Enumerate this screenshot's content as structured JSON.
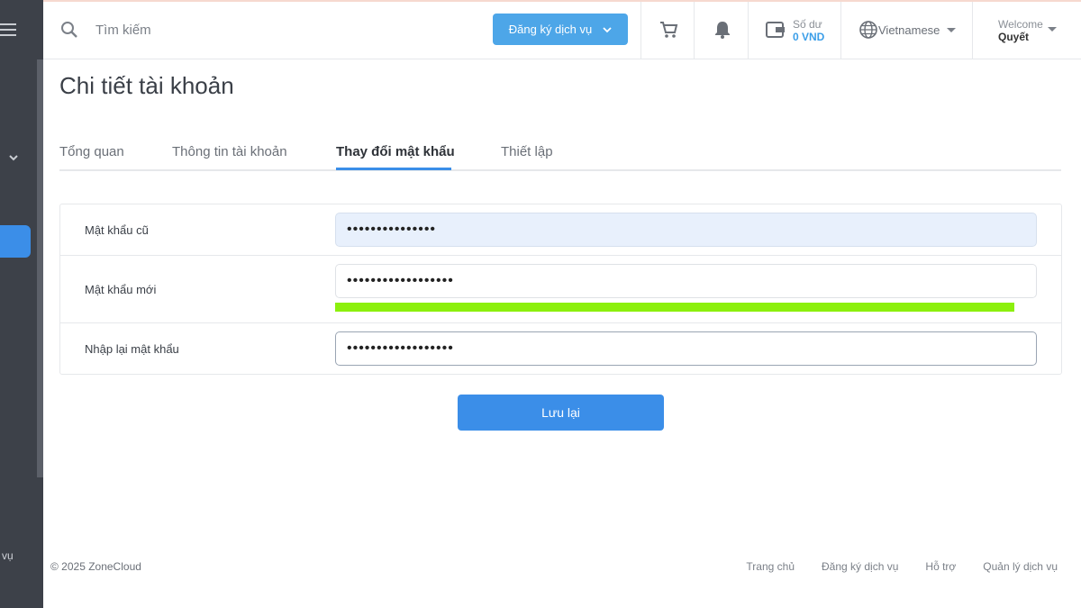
{
  "header": {
    "search_placeholder": "Tìm kiếm",
    "register_label": "Đăng ký dịch vụ",
    "balance_label": "Số dư",
    "balance_value": "0 VND",
    "language": "Vietnamese",
    "welcome_label": "Welcome",
    "user_name": "Quyết"
  },
  "sidebar": {
    "bottom_text": "vụ"
  },
  "page": {
    "title": "Chi tiết tài khoản"
  },
  "tabs": [
    {
      "label": "Tổng quan",
      "active": false
    },
    {
      "label": "Thông tin tài khoản",
      "active": false
    },
    {
      "label": "Thay đổi mật khẩu",
      "active": true
    },
    {
      "label": "Thiết lập",
      "active": false
    }
  ],
  "form": {
    "old_password_label": "Mật khẩu cũ",
    "old_password_value": "•••••••••••••••",
    "new_password_label": "Mật khẩu mới",
    "new_password_value": "••••••••••••••••••",
    "confirm_password_label": "Nhập lại mật khẩu",
    "confirm_password_value": "••••••••••••••••••",
    "strength_level": 1.0,
    "strength_color": "#8cf00d",
    "save_label": "Lưu lại"
  },
  "footer": {
    "copyright": "© 2025 ZoneCloud",
    "links": [
      "Trang chủ",
      "Đăng ký dịch vụ",
      "Hỗ trợ",
      "Quản lý dịch vụ"
    ]
  },
  "colors": {
    "accent": "#3b8ee8",
    "sidebar": "#3d4149"
  }
}
